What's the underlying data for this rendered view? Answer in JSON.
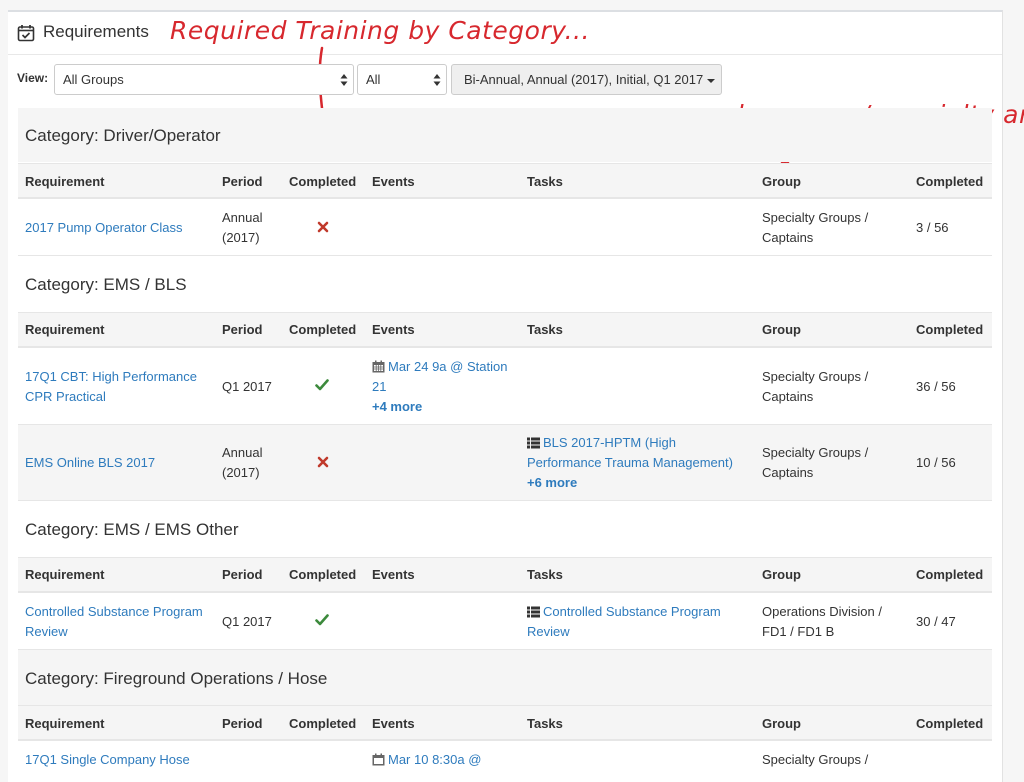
{
  "panel": {
    "title": "Requirements",
    "icon": "calendar-check-icon"
  },
  "annotations": {
    "by_category": "Required Training by Category...",
    "by_group": "... or by group / specialty area"
  },
  "filters": {
    "view_label": "View:",
    "group_select": "All Groups",
    "status_select": "All",
    "periods_button": "Bi-Annual, Annual (2017), Initial, Q1 2017"
  },
  "columns": [
    "Requirement",
    "Period",
    "Completed",
    "Events",
    "Tasks",
    "Group",
    "Completed"
  ],
  "categories": [
    {
      "title": "Category: Driver/Operator",
      "rows": [
        {
          "requirement": "2017 Pump Operator Class",
          "period": "Annual (2017)",
          "completed": "no",
          "events": "",
          "events_more": "",
          "tasks": "",
          "tasks_more": "",
          "group": "Specialty Groups / Captains",
          "count": "3 / 56"
        }
      ]
    },
    {
      "title": "Category: EMS / BLS",
      "rows": [
        {
          "requirement": "17Q1 CBT: High Performance CPR Practical",
          "period": "Q1 2017",
          "completed": "yes",
          "events": "Mar 24 9a @ Station 21",
          "events_more": "+4 more",
          "tasks": "",
          "tasks_more": "",
          "group": "Specialty Groups / Captains",
          "count": "36 / 56"
        },
        {
          "requirement": "EMS Online BLS 2017",
          "period": "Annual (2017)",
          "completed": "no",
          "events": "",
          "events_more": "",
          "tasks": "BLS 2017-HPTM (High Performance Trauma Management)",
          "tasks_more": "+6 more",
          "group": "Specialty Groups / Captains",
          "count": "10 / 56"
        }
      ]
    },
    {
      "title": "Category: EMS / EMS Other",
      "rows": [
        {
          "requirement": "Controlled Substance Program Review",
          "period": "Q1 2017",
          "completed": "yes",
          "events": "",
          "events_more": "",
          "tasks": "Controlled Substance Program Review",
          "tasks_more": "",
          "group": "Operations Division / FD1 / FD1 B",
          "count": "30 / 47"
        }
      ]
    },
    {
      "title": "Category: Fireground Operations / Hose",
      "rows": [
        {
          "requirement": "17Q1 Single Company Hose",
          "period": "",
          "completed": "",
          "events": "Mar 10 8:30a @",
          "events_more": "",
          "tasks": "",
          "tasks_more": "",
          "group": "Specialty Groups /",
          "count": ""
        }
      ]
    }
  ],
  "colors": {
    "link": "#2e7bbd",
    "check": "#3c8a3c",
    "cross": "#c0392b",
    "annotation": "#d7282e"
  }
}
